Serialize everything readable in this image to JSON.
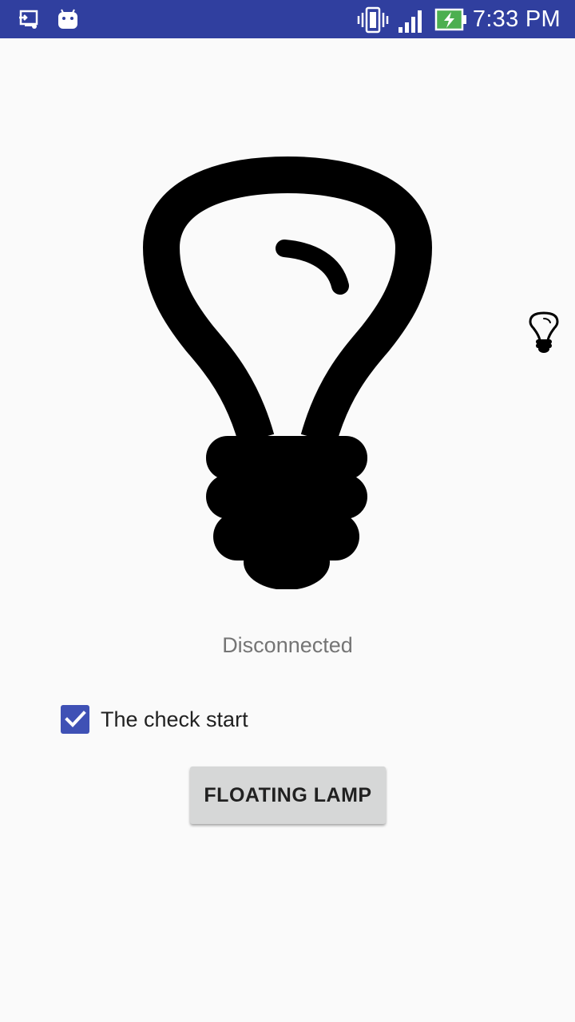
{
  "status_bar": {
    "time": "7:33 PM",
    "background_color": "#303f9f",
    "icons": [
      "cast-screen-icon",
      "android-icon",
      "vibrate-icon",
      "signal-icon",
      "battery-charging-icon"
    ]
  },
  "main": {
    "lamp_icon": "lightbulb-icon",
    "floating_lamp_icon": "lightbulb-icon",
    "connection_status": "Disconnected",
    "checkbox": {
      "label": "The check start",
      "checked": true,
      "color": "#3f51b5"
    },
    "floating_lamp_button_label": "FLOATING LAMP"
  }
}
